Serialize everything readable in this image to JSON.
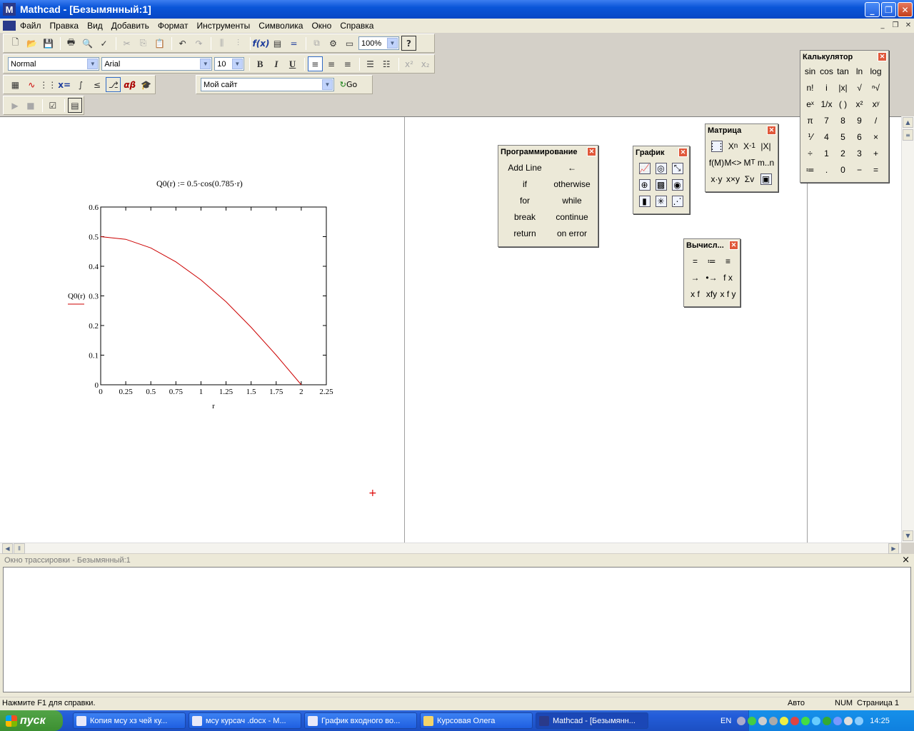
{
  "window": {
    "title": "Mathcad - [Безымянный:1]",
    "app_icon": "M"
  },
  "menu": [
    "Файл",
    "Правка",
    "Вид",
    "Добавить",
    "Формат",
    "Инструменты",
    "Символика",
    "Окно",
    "Справка"
  ],
  "toolbar": {
    "zoom": "100%",
    "style": "Normal",
    "font": "Arial",
    "size": "10",
    "bold": "B",
    "italic": "I",
    "underline": "U",
    "url_combo": "Мой сайт",
    "go_label": "Go"
  },
  "doc": {
    "definition": "Q0(r) := 0.5·cos(0.785·r)",
    "cursor_glyph": "+"
  },
  "chart_data": {
    "type": "line",
    "function": "Q0(r) = 0.5·cos(0.785·r)",
    "xlabel": "r",
    "ylabel": "Q0(r)",
    "xlim": [
      0,
      2.25
    ],
    "ylim": [
      0,
      0.6
    ],
    "xticks": [
      "0",
      "0.25",
      "0.5",
      "0.75",
      "1",
      "1.25",
      "1.5",
      "1.75",
      "2",
      "2.25"
    ],
    "yticks": [
      "0",
      "0.1",
      "0.2",
      "0.3",
      "0.4",
      "0.5",
      "0.6"
    ],
    "series": [
      {
        "color": "#cc0000",
        "x": [
          0,
          0.25,
          0.5,
          0.75,
          1,
          1.25,
          1.5,
          1.75,
          2
        ],
        "y": [
          0.5,
          0.491,
          0.462,
          0.415,
          0.354,
          0.28,
          0.194,
          0.1,
          0.0
        ]
      }
    ],
    "grid": false
  },
  "palettes": {
    "calc": {
      "title": "Калькулятор",
      "keys": [
        "sin",
        "cos",
        "tan",
        "ln",
        "log",
        "n!",
        "i",
        "|x|",
        "√",
        "ⁿ√",
        "eˣ",
        "1/x",
        "( )",
        "x²",
        "xʸ",
        "π",
        "7",
        "8",
        "9",
        "/",
        "⅟",
        "4",
        "5",
        "6",
        "×",
        "÷",
        "1",
        "2",
        "3",
        "+",
        "≔",
        ".",
        "0",
        "−",
        "="
      ]
    },
    "matrix": {
      "title": "Матрица"
    },
    "graph": {
      "title": "График"
    },
    "prog": {
      "title": "Программирование",
      "keys": [
        "Add Line",
        "←",
        "if",
        "otherwise",
        "for",
        "while",
        "break",
        "continue",
        "return",
        "on error"
      ]
    },
    "eval": {
      "title": "Вычисл...",
      "keys": [
        "=",
        "≔",
        "≡",
        "→",
        "•→",
        "f x",
        "x f",
        "xfy",
        "x f y"
      ]
    }
  },
  "trace": {
    "title": "Окно трассировки - Безымянный:1",
    "close": "×"
  },
  "status": {
    "help": "Нажмите F1 для справки.",
    "mode": "Авто",
    "num": "NUM",
    "page": "Страница 1"
  },
  "taskbar": {
    "start": "пуск",
    "tasks": [
      "Копия мсу хз чей ку...",
      "мсу курсач .docx - М...",
      "График входного во...",
      "Курсовая Олега",
      "Mathcad - [Безымянн..."
    ],
    "lang": "EN",
    "clock": "14:25"
  }
}
